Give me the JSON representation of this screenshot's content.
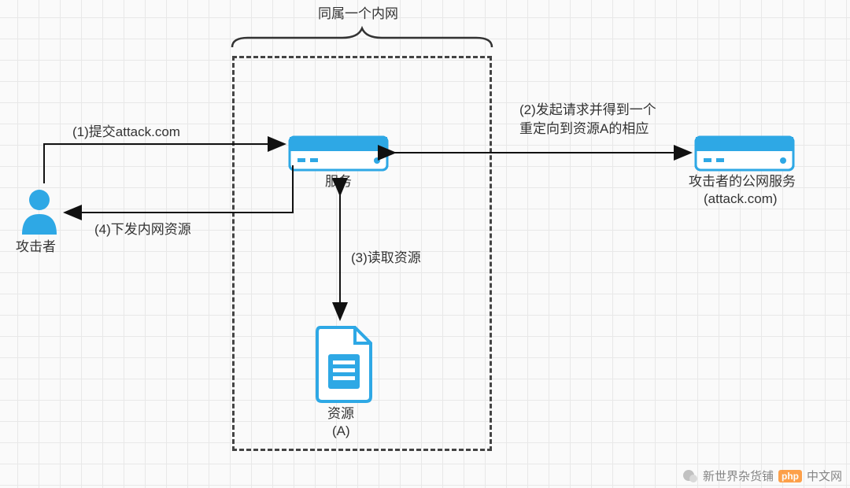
{
  "diagram": {
    "title_top": "同属一个内网",
    "attacker_label": "攻击者",
    "service_label": "服务",
    "resource_label_line1": "资源",
    "resource_label_line2": "(A)",
    "public_service_label_line1": "攻击者的公网服务",
    "public_service_label_line2": "(attack.com)",
    "step1": "(1)提交attack.com",
    "step2_line1": "(2)发起请求并得到一个",
    "step2_line2": "重定向到资源A的相应",
    "step3": "(3)读取资源",
    "step4": "(4)下发内网资源"
  },
  "watermark": {
    "source": "新世界杂货铺",
    "badge": "php",
    "tail": "中文网"
  },
  "colors": {
    "accent": "#2ea8e5",
    "line": "#111111",
    "text": "#333333"
  }
}
